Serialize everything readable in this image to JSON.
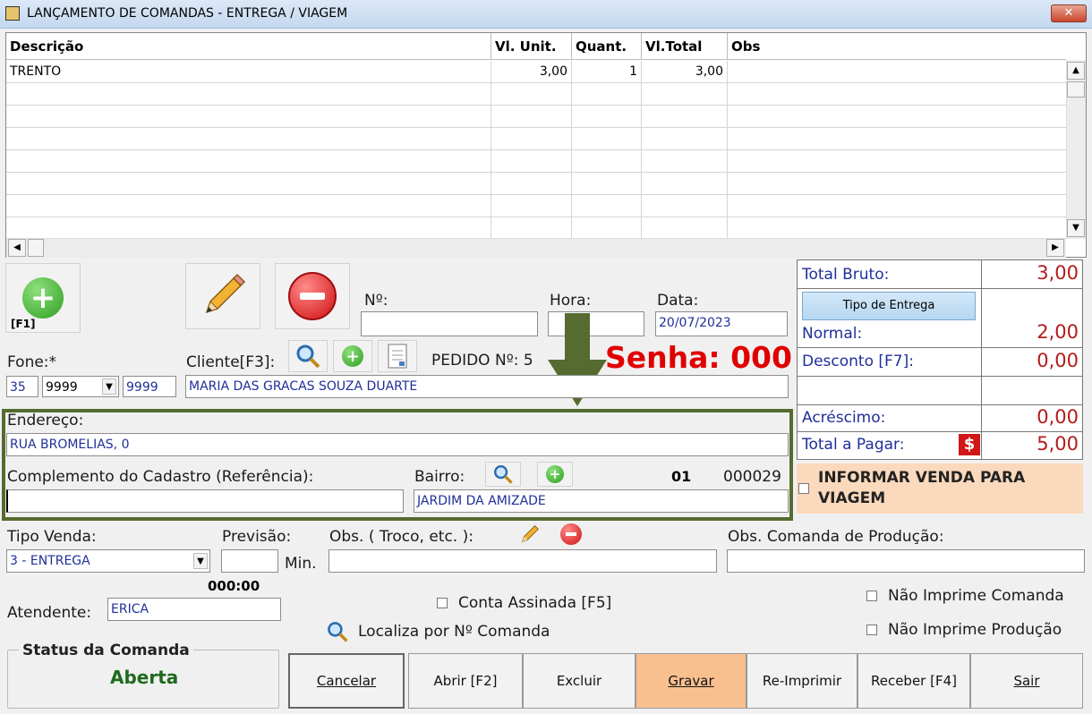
{
  "window": {
    "title": "LANÇAMENTO DE COMANDAS - ENTREGA / VIAGEM",
    "close_label": "✕"
  },
  "grid": {
    "columns": [
      "Descrição",
      "Vl. Unit.",
      "Quant.",
      "Vl.Total",
      "Obs"
    ],
    "rows": [
      {
        "descricao": "TRENTO",
        "vl_unit": "3,00",
        "quant": "1",
        "vl_total": "3,00",
        "obs": ""
      }
    ]
  },
  "toolbar": {
    "add_hint": "[F1]"
  },
  "header_fields": {
    "numero_label": "Nº:",
    "numero_value": "",
    "hora_label": "Hora:",
    "hora_value": "",
    "data_label": "Data:",
    "data_value": "20/07/2023"
  },
  "customer": {
    "fone_label": "Fone:*",
    "fone_ddd": "35",
    "fone_prefix": "9999",
    "fone_suffix": "9999",
    "cliente_label": "Cliente[F3]:",
    "cliente_value": "MARIA DAS GRACAS SOUZA DUARTE",
    "pedido_label": "PEDIDO Nº: 5",
    "senha_label": "Senha: 000"
  },
  "address": {
    "endereco_label": "Endereço:",
    "endereco_value": "RUA BROMELIAS, 0",
    "complemento_label": "Complemento do Cadastro (Referência):",
    "complemento_value": "",
    "bairro_label": "Bairro:",
    "bairro_code": "01",
    "bairro_id": "000029",
    "bairro_value": "JARDIM DA AMIZADE"
  },
  "totals": {
    "total_bruto_label": "Total Bruto:",
    "total_bruto_value": "3,00",
    "tipo_entrega_button": "Tipo de Entrega",
    "normal_label": "Normal:",
    "normal_value": "2,00",
    "desconto_label": "Desconto [F7]:",
    "desconto_value": "0,00",
    "acrescimo_label": "Acréscimo:",
    "acrescimo_value": "0,00",
    "total_pagar_label": "Total a Pagar:",
    "total_pagar_value": "5,00"
  },
  "viagem": {
    "label_line1": "INFORMAR VENDA PARA",
    "label_line2": "VIAGEM"
  },
  "venda": {
    "tipo_label": "Tipo Venda:",
    "tipo_value": "3 - ENTREGA",
    "previsao_label": "Previsão:",
    "previsao_value": "",
    "min_label": "Min.",
    "obs_label": "Obs. ( Troco, etc. ):",
    "obs_value": "",
    "obs_producao_label": "Obs. Comanda de Produção:",
    "obs_producao_value": "",
    "timer": "000:00",
    "atendente_label": "Atendente:",
    "atendente_value": "ERICA"
  },
  "options": {
    "conta_assinada": "Conta Assinada [F5]",
    "nao_imprime_comanda": "Não Imprime Comanda",
    "nao_imprime_producao": "Não Imprime Produção",
    "localiza": "Localiza por Nº Comanda"
  },
  "status": {
    "title": "Status da Comanda",
    "value": "Aberta"
  },
  "buttons": {
    "cancelar": "Cancelar",
    "abrir": "Abrir [F2]",
    "excluir": "Excluir",
    "gravar": "Gravar",
    "reimprimir": "Re-Imprimir",
    "receber": "Receber [F4]",
    "sair": "Sair"
  },
  "colors": {
    "accent_red": "#e00000",
    "highlight_green": "#556b2f",
    "gravar_bg": "#f9c08f",
    "viagem_bg": "#fbd9bc",
    "status_green": "#1e6b1e"
  }
}
